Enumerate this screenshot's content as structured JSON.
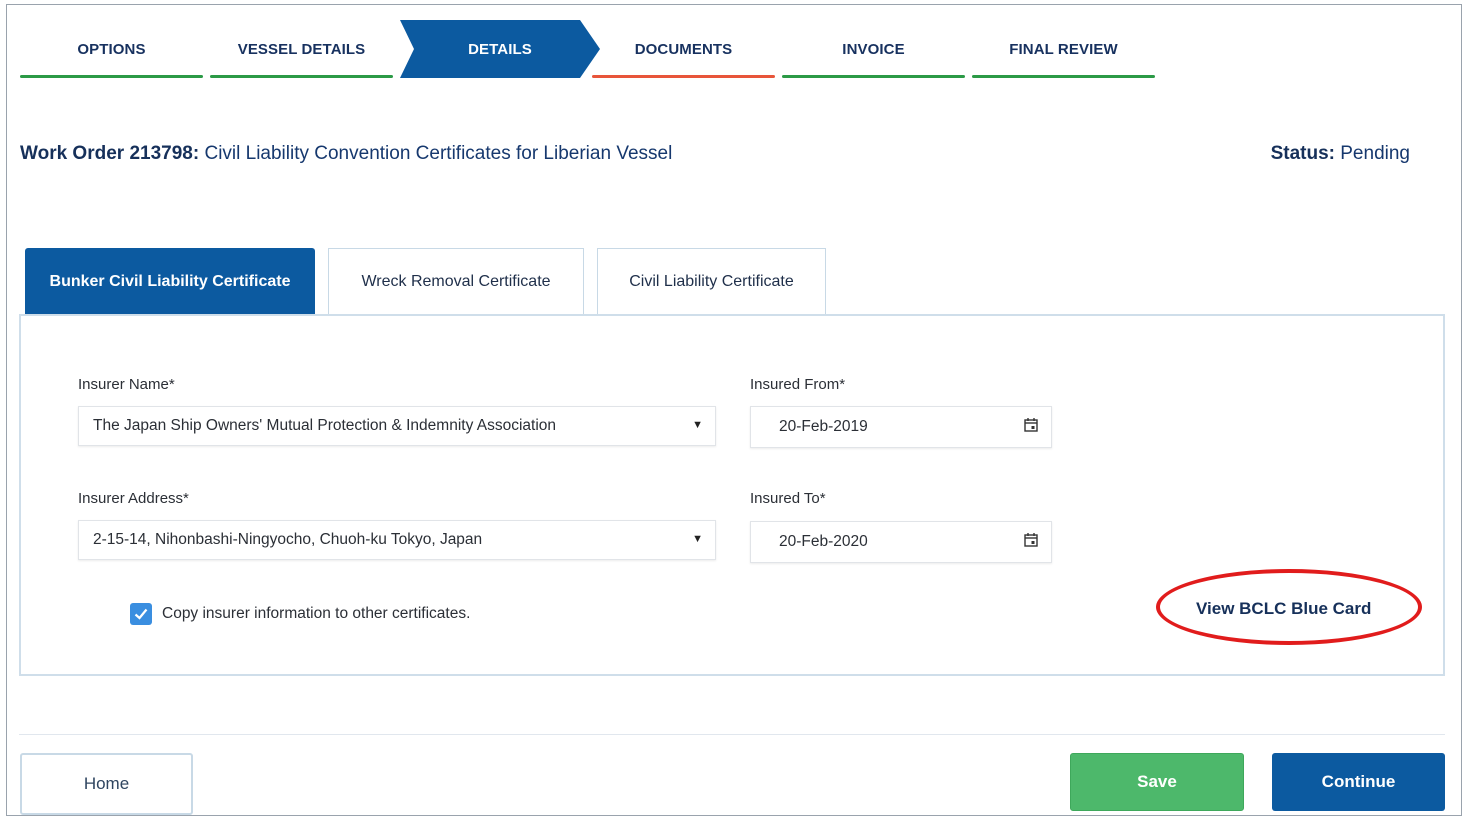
{
  "stepper": {
    "steps": [
      {
        "label": "OPTIONS",
        "state": "complete"
      },
      {
        "label": "VESSEL DETAILS",
        "state": "complete"
      },
      {
        "label": "DETAILS",
        "state": "active"
      },
      {
        "label": "DOCUMENTS",
        "state": "in-progress"
      },
      {
        "label": "INVOICE",
        "state": "complete"
      },
      {
        "label": "FINAL REVIEW",
        "state": "complete"
      }
    ]
  },
  "header": {
    "work_order_label": "Work Order 213798:",
    "work_order_title": " Civil Liability Convention Certificates for Liberian Vessel",
    "status_label": "Status:",
    "status_value": " Pending"
  },
  "tabs": [
    {
      "label": "Bunker Civil Liability Certificate",
      "active": true
    },
    {
      "label": "Wreck Removal Certificate",
      "active": false
    },
    {
      "label": "Civil Liability Certificate",
      "active": false
    }
  ],
  "form": {
    "insurer_name_label": "Insurer Name*",
    "insurer_name_value": "The Japan Ship Owners' Mutual Protection & Indemnity Association",
    "insurer_address_label": "Insurer Address*",
    "insurer_address_value": "2-15-14, Nihonbashi-Ningyocho, Chuoh-ku Tokyo, Japan",
    "insured_from_label": "Insured From*",
    "insured_from_value": "20-Feb-2019",
    "insured_to_label": "Insured To*",
    "insured_to_value": "20-Feb-2020",
    "copy_checkbox_label": "Copy insurer information to other certificates.",
    "copy_checked": true,
    "view_card_link": "View BCLC Blue Card"
  },
  "footer": {
    "home_label": "Home",
    "save_label": "Save",
    "continue_label": "Continue"
  },
  "colors": {
    "primary": "#0c5aa0",
    "complete": "#2b9a46",
    "in_progress": "#e8553a",
    "save": "#4db86b",
    "highlight_oval": "#e11c1c"
  }
}
